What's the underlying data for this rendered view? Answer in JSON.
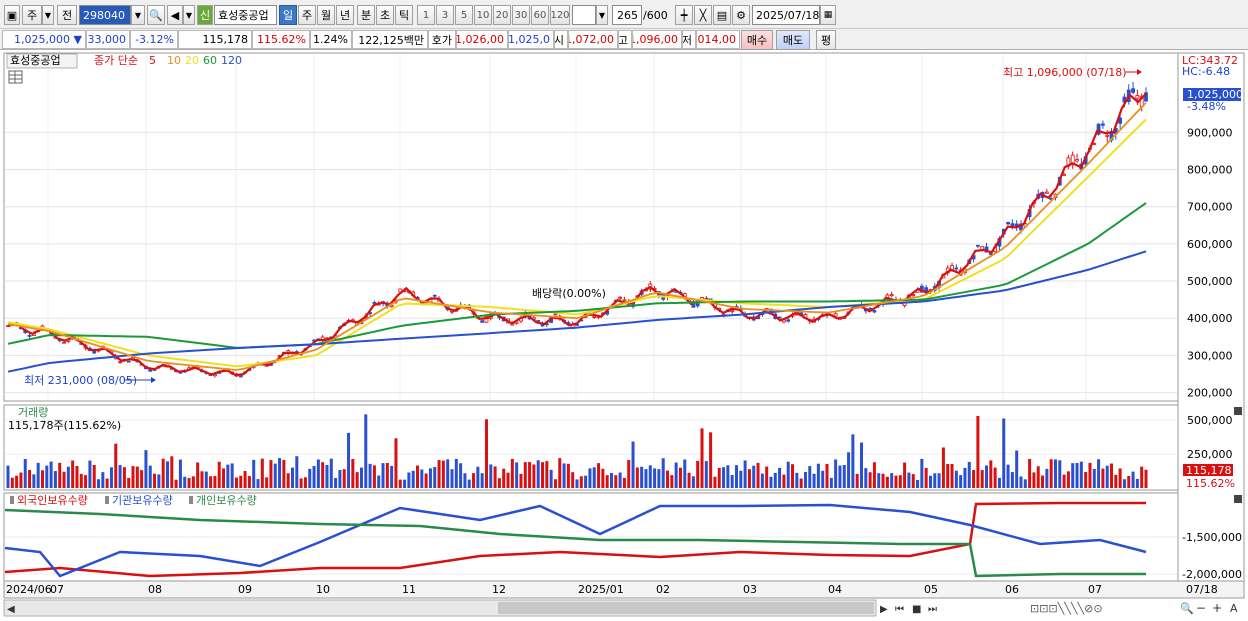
{
  "toolbar": {
    "market": "주",
    "prev_label": "전",
    "stock_code": "298040",
    "badge": "신",
    "stock_name": "효성중공업",
    "periods": [
      "일",
      "주",
      "월",
      "년",
      "분",
      "초",
      "틱"
    ],
    "active_period": "일",
    "intervals": [
      "1",
      "3",
      "5",
      "10",
      "20",
      "30",
      "60",
      "120"
    ],
    "count_value": "265",
    "count_total": "/600",
    "date_value": "2025/07/18"
  },
  "quote": {
    "price": "1,025,000",
    "change": "33,000",
    "change_pct": "-3.12%",
    "volume": "115,178",
    "volume_ratio": "115.62%",
    "turnover": "1.24%",
    "amount": "122,125백만",
    "ask_label": "호가",
    "ask_value": "1,026,00",
    "bid_value": "1,025,0",
    "open_label": "시",
    "open_value": "1,072,00",
    "high_label": "고",
    "high_value": "1,096,00",
    "low_label": "저",
    "low_value": "1,014,00",
    "buy_button": "매수",
    "sell_button": "매도",
    "eval_button": "평"
  },
  "price_panel": {
    "legend_name": "효성중공업",
    "legend_ma": "종가 단순",
    "ma_labels": [
      "5",
      "10",
      "20",
      "60",
      "120"
    ],
    "ma_colors": [
      "#d81010",
      "#e8901e",
      "#f0e020",
      "#1a9a3a",
      "#2850d0"
    ],
    "high_note": "최고 1,096,000 (07/18)",
    "low_note": "최저 231,000 (08/05)",
    "dividend_note": "배당락(0.00%)",
    "lc_label": "LC:343.72",
    "hc_label": "HC:-6.48",
    "current_tag": "1,025,000",
    "current_pct": "-3.48%",
    "y_ticks": [
      "900,000",
      "800,000",
      "700,000",
      "600,000",
      "500,000",
      "400,000",
      "300,000",
      "200,000"
    ]
  },
  "volume_panel": {
    "title": "거래량",
    "value_note": "115,178주(115.62%)",
    "tag": "115,178",
    "tag_pct": "115.62%",
    "y_ticks": [
      "500,000",
      "250,000"
    ]
  },
  "holder_panel": {
    "labels": [
      "외국인보유수량",
      "기관보유수량",
      "개인보유수량"
    ],
    "colors": [
      "#d81010",
      "#2850d0",
      "#2a8a4a"
    ],
    "y_ticks": [
      "-1,500,000",
      "-2,000,000"
    ]
  },
  "x_axis": {
    "labels": [
      "2024/06",
      "07",
      "08",
      "09",
      "10",
      "11",
      "12",
      "2025/01",
      "02",
      "03",
      "04",
      "05",
      "06",
      "07"
    ],
    "end_label": "07/18"
  },
  "chart_data": {
    "type": "line",
    "x_range": [
      "2024/06",
      "2025/07/18"
    ],
    "price_range": [
      200000,
      1100000
    ],
    "series": [
      {
        "name": "5",
        "color": "#d81010",
        "x": [
          "2024/06",
          "2024/07",
          "2024/08",
          "2024/09",
          "2024/10",
          "2024/11",
          "2024/12",
          "2025/01",
          "2025/02",
          "2025/03",
          "2025/04",
          "2025/05",
          "2025/06",
          "2025/07",
          "2025/07/18"
        ],
        "values": [
          380000,
          360000,
          270000,
          250000,
          330000,
          470000,
          400000,
          390000,
          480000,
          410000,
          400000,
          470000,
          620000,
          850000,
          1025000
        ]
      },
      {
        "name": "20",
        "color": "#f0e020",
        "x": [
          "2024/06",
          "2024/07",
          "2024/08",
          "2024/09",
          "2024/10",
          "2024/11",
          "2024/12",
          "2025/01",
          "2025/02",
          "2025/03",
          "2025/04",
          "2025/05",
          "2025/06",
          "2025/07",
          "2025/07/18"
        ],
        "values": [
          390000,
          370000,
          300000,
          270000,
          300000,
          440000,
          430000,
          410000,
          460000,
          440000,
          430000,
          450000,
          560000,
          780000,
          935000
        ]
      },
      {
        "name": "60",
        "color": "#1a9a3a",
        "x": [
          "2024/06",
          "2024/07",
          "2024/08",
          "2024/09",
          "2024/10",
          "2024/11",
          "2024/12",
          "2025/01",
          "2025/02",
          "2025/03",
          "2025/04",
          "2025/05",
          "2025/06",
          "2025/07",
          "2025/07/18"
        ],
        "values": [
          330000,
          355000,
          350000,
          320000,
          330000,
          380000,
          410000,
          420000,
          440000,
          445000,
          445000,
          450000,
          490000,
          600000,
          710000
        ]
      },
      {
        "name": "120",
        "color": "#2850d0",
        "x": [
          "2024/06",
          "2024/07",
          "2024/08",
          "2024/09",
          "2024/10",
          "2024/11",
          "2024/12",
          "2025/01",
          "2025/02",
          "2025/03",
          "2025/04",
          "2025/05",
          "2025/06",
          "2025/07",
          "2025/07/18"
        ],
        "values": [
          255000,
          280000,
          305000,
          320000,
          330000,
          345000,
          360000,
          375000,
          395000,
          410000,
          430000,
          445000,
          475000,
          530000,
          580000
        ]
      }
    ]
  }
}
